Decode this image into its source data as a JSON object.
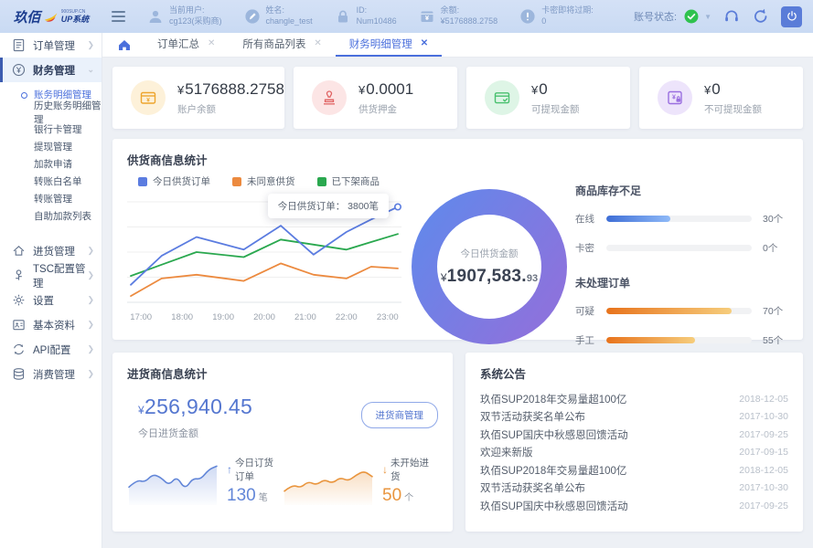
{
  "header": {
    "logo": {
      "name": "玖佰",
      "sub": "UP系统",
      "tag": "900SUP.CN"
    },
    "items": [
      {
        "icon": "user-icon",
        "label": "当前用户:",
        "value": "cg123(采购商)"
      },
      {
        "icon": "edit-icon",
        "label": "姓名:",
        "value": "changle_test"
      },
      {
        "icon": "lock-icon",
        "label": "ID:",
        "value": "Num10486"
      },
      {
        "icon": "balance-icon",
        "label": "余额:",
        "value": "¥5176888.2758"
      },
      {
        "icon": "expire-icon",
        "label": "卡密即将过期:",
        "value": "0"
      }
    ],
    "account_status_label": "账号状态:"
  },
  "tabbar": {
    "tabs": [
      {
        "label": "订单汇总"
      },
      {
        "label": "所有商品列表"
      },
      {
        "label": "财务明细管理"
      }
    ]
  },
  "sidebar": {
    "items": [
      {
        "label": "订单管理"
      },
      {
        "label": "财务管理",
        "children": [
          "账务明细管理",
          "历史账务明细管理",
          "银行卡管理",
          "提现管理",
          "加款申请",
          "转账白名单",
          "转账管理",
          "自助加款列表"
        ]
      },
      {
        "label": "进货管理"
      },
      {
        "label": "TSC配置管理"
      },
      {
        "label": "设置"
      },
      {
        "label": "基本资料"
      },
      {
        "label": "API配置"
      },
      {
        "label": "消费管理"
      }
    ]
  },
  "cards": [
    {
      "currency": "¥",
      "amount": "5176888.2758",
      "label": "账户余额",
      "icon": "wallet-icon",
      "fg": "#eda52e",
      "bg": "#fdf1d9"
    },
    {
      "currency": "¥",
      "amount": "0.0001",
      "label": "供货押金",
      "icon": "deposit-stamp-icon",
      "fg": "#e06262",
      "bg": "#fce5e5"
    },
    {
      "currency": "¥",
      "amount": "0",
      "label": "可提现金额",
      "icon": "withdraw-card-icon",
      "fg": "#48c06e",
      "bg": "#def5e6"
    },
    {
      "currency": "¥",
      "amount": "0",
      "label": "不可提现金额",
      "icon": "locked-card-icon",
      "fg": "#9a6ee0",
      "bg": "#ede4fb"
    }
  ],
  "supplier_panel": {
    "title": "供货商信息统计",
    "tooltip": "今日供货订单： 3800笔",
    "chart_data": {
      "type": "line",
      "x_ticks": [
        "17:00",
        "18:00",
        "19:00",
        "20:00",
        "21:00",
        "22:00",
        "23:00"
      ],
      "x_tick_hours": [
        17,
        18,
        19,
        20,
        21,
        22,
        23
      ],
      "x_range": [
        16.75,
        23.25
      ],
      "ylim": [
        0,
        4000
      ],
      "grid": true,
      "legend_position": "top",
      "x": [
        16.75,
        17.5,
        18.35,
        19.5,
        20.4,
        21.2,
        22.0,
        22.6,
        23.25
      ],
      "series": [
        {
          "name": "今日供货订单",
          "color": "#5b7ce0",
          "values": [
            700,
            1850,
            2600,
            2100,
            3050,
            1900,
            2800,
            3300,
            3800
          ]
        },
        {
          "name": "未同意供货",
          "color": "#ec8a3f",
          "values": [
            250,
            950,
            1100,
            850,
            1550,
            1100,
            950,
            1420,
            1350
          ]
        },
        {
          "name": "已下架商品",
          "color": "#2aa84f",
          "values": [
            1050,
            1500,
            2000,
            1800,
            2500,
            2300,
            2100,
            2400,
            2720
          ]
        }
      ]
    },
    "donut": {
      "label": "今日供货金额",
      "currency": "¥",
      "amount": "1907,583.",
      "cents": "93",
      "gradient": [
        "#6487ea",
        "#8b73dd"
      ]
    },
    "stock": {
      "title": "商品库存不足",
      "bars": [
        {
          "label": "在线",
          "value": "30个",
          "fraction": 0.44,
          "colors": [
            "#3e6ed6",
            "#8fbaf8"
          ]
        },
        {
          "label": "卡密",
          "value": "0个",
          "fraction": 0,
          "colors": [
            "#3e6ed6",
            "#8fbaf8"
          ]
        }
      ]
    },
    "pending": {
      "title": "未处理订单",
      "bars": [
        {
          "label": "可疑",
          "value": "70个",
          "fraction": 0.86,
          "colors": [
            "#e8731c",
            "#f6cd7c"
          ]
        },
        {
          "label": "手工",
          "value": "55个",
          "fraction": 0.61,
          "colors": [
            "#e8731c",
            "#f6cd7c"
          ]
        }
      ]
    }
  },
  "purchase_panel": {
    "title": "进货商信息统计",
    "currency": "¥",
    "amount": "256,940.45",
    "caption": "今日进货金额",
    "button": "进货商管理",
    "stats": [
      {
        "arrow": "↑",
        "label": "今日订货订单",
        "value": "130",
        "unit": "笔",
        "color": "#6286d8",
        "spark_values": [
          38,
          56,
          50,
          70,
          62,
          42,
          65,
          32,
          60,
          57,
          82,
          90
        ]
      },
      {
        "arrow": "↓",
        "label": "未开始进货",
        "value": "50",
        "unit": "个",
        "color": "#e9953e",
        "spark_values": [
          28,
          44,
          36,
          52,
          43,
          57,
          47,
          62,
          53,
          68,
          78,
          64
        ]
      }
    ]
  },
  "notices_panel": {
    "title": "系统公告",
    "items": [
      {
        "text": "玖佰SUP2018年交易量超100亿",
        "date": "2018-12-05"
      },
      {
        "text": "双节活动获奖名单公布",
        "date": "2017-10-30"
      },
      {
        "text": "玖佰SUP国庆中秋感恩回馈活动",
        "date": "2017-09-25"
      },
      {
        "text": "欢迎来新版",
        "date": "2017-09-15"
      },
      {
        "text": "玖佰SUP2018年交易量超100亿",
        "date": "2018-12-05"
      },
      {
        "text": "双节活动获奖名单公布",
        "date": "2017-10-30"
      },
      {
        "text": "玖佰SUP国庆中秋感恩回馈活动",
        "date": "2017-09-25"
      }
    ]
  }
}
